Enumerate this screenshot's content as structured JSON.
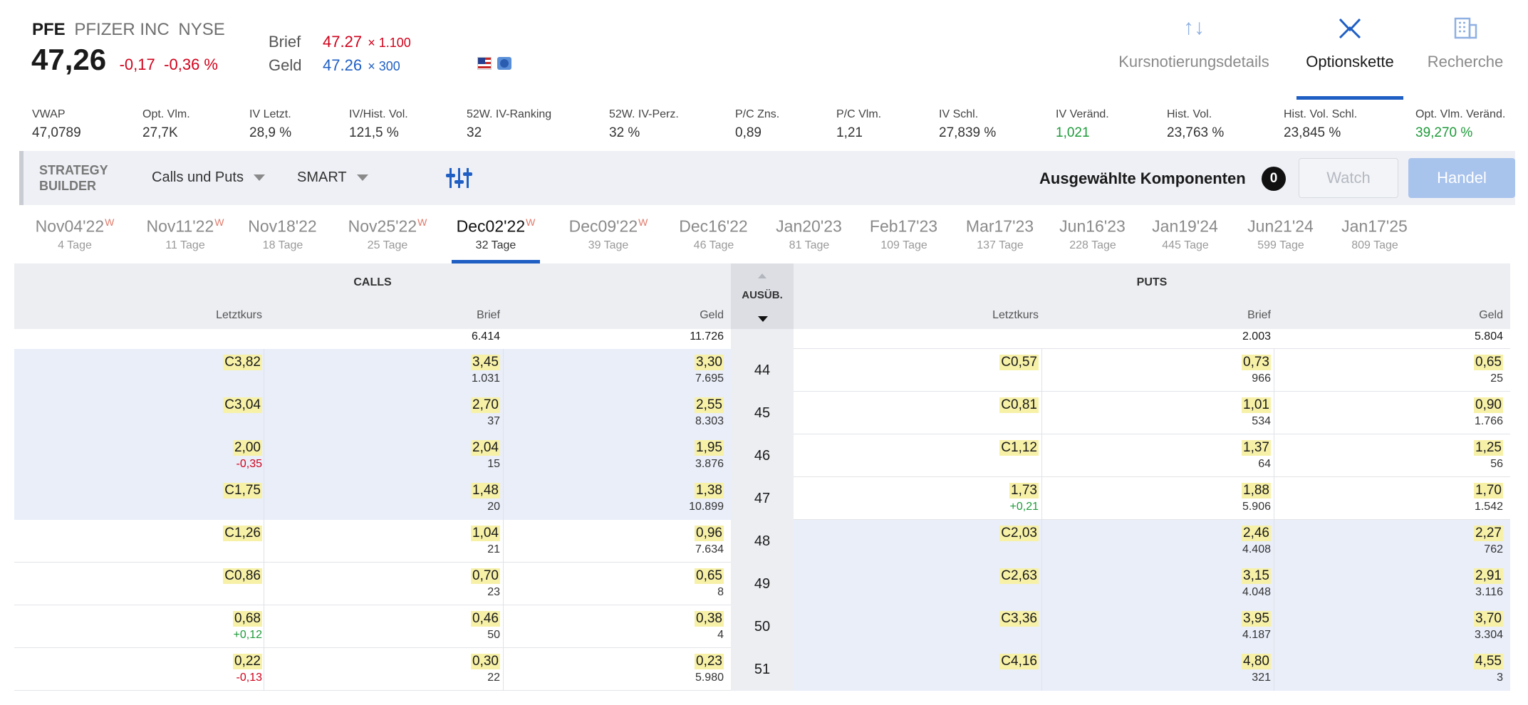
{
  "header": {
    "symbol": "PFE",
    "company": "PFIZER INC",
    "exchange": "NYSE",
    "last_price": "47,26",
    "change": "-0,17",
    "change_pct": "-0,36 %",
    "ask_label": "Brief",
    "ask_price": "47.27",
    "ask_size": "× 1.100",
    "bid_label": "Geld",
    "bid_price": "47.26",
    "bid_size": "× 300"
  },
  "nav_tabs": [
    {
      "label": "Kursnotierungsdetails",
      "icon": "sort-arrows-icon",
      "active": false
    },
    {
      "label": "Optionskette",
      "icon": "options-chain-icon",
      "active": true
    },
    {
      "label": "Recherche",
      "icon": "building-icon",
      "active": false
    }
  ],
  "stats": [
    {
      "label": "VWAP",
      "value": "47,0789",
      "tone": "neutral"
    },
    {
      "label": "Opt. Vlm.",
      "value": "27,7K",
      "tone": "neutral"
    },
    {
      "label": "IV Letzt.",
      "value": "28,9 %",
      "tone": "neutral"
    },
    {
      "label": "IV/Hist. Vol.",
      "value": "121,5 %",
      "tone": "neutral"
    },
    {
      "label": "52W. IV-Ranking",
      "value": "32",
      "tone": "neutral"
    },
    {
      "label": "52W. IV-Perz.",
      "value": "32 %",
      "tone": "neutral"
    },
    {
      "label": "P/C Zns.",
      "value": "0,89",
      "tone": "neutral"
    },
    {
      "label": "P/C Vlm.",
      "value": "1,21",
      "tone": "neutral"
    },
    {
      "label": "IV Schl.",
      "value": "27,839 %",
      "tone": "neutral"
    },
    {
      "label": "IV Veränd.",
      "value": "1,021",
      "tone": "positive"
    },
    {
      "label": "Hist. Vol.",
      "value": "23,763 %",
      "tone": "neutral"
    },
    {
      "label": "Hist. Vol. Schl.",
      "value": "23,845 %",
      "tone": "neutral"
    },
    {
      "label": "Opt. Vlm. Veränd.",
      "value": "39,270 %",
      "tone": "positive"
    }
  ],
  "toolbar": {
    "strategy_builder_line1": "STRATEGY",
    "strategy_builder_line2": "BUILDER",
    "type_dropdown": "Calls und Puts",
    "exchange_dropdown": "SMART",
    "selected_label": "Ausgewählte Komponenten",
    "selected_count": "0",
    "watch_label": "Watch",
    "trade_label": "Handel"
  },
  "expiries": [
    {
      "date": "Nov04'22",
      "weekly": "W",
      "days": "4 Tage",
      "active": false
    },
    {
      "date": "Nov11'22",
      "weekly": "W",
      "days": "11 Tage",
      "active": false
    },
    {
      "date": "Nov18'22",
      "weekly": "",
      "days": "18 Tage",
      "active": false
    },
    {
      "date": "Nov25'22",
      "weekly": "W",
      "days": "25 Tage",
      "active": false
    },
    {
      "date": "Dec02'22",
      "weekly": "W",
      "days": "32 Tage",
      "active": true
    },
    {
      "date": "Dec09'22",
      "weekly": "W",
      "days": "39 Tage",
      "active": false
    },
    {
      "date": "Dec16'22",
      "weekly": "",
      "days": "46 Tage",
      "active": false
    },
    {
      "date": "Jan20'23",
      "weekly": "",
      "days": "81 Tage",
      "active": false
    },
    {
      "date": "Feb17'23",
      "weekly": "",
      "days": "109 Tage",
      "active": false
    },
    {
      "date": "Mar17'23",
      "weekly": "",
      "days": "137 Tage",
      "active": false
    },
    {
      "date": "Jun16'23",
      "weekly": "",
      "days": "228 Tage",
      "active": false
    },
    {
      "date": "Jan19'24",
      "weekly": "",
      "days": "445 Tage",
      "active": false
    },
    {
      "date": "Jun21'24",
      "weekly": "",
      "days": "599 Tage",
      "active": false
    },
    {
      "date": "Jan17'25",
      "weekly": "",
      "days": "809 Tage",
      "active": false
    }
  ],
  "chain": {
    "calls_title": "CALLS",
    "puts_title": "PUTS",
    "strike_title": "AUSÜB.",
    "col_last": "Letztkurs",
    "col_ask": "Brief",
    "col_bid": "Geld",
    "partial_row": {
      "call_ask_size": "6.414",
      "call_bid_size": "11.726",
      "put_ask_size": "2.003",
      "put_bid_size": "5.804"
    },
    "rows": [
      {
        "strike": "44",
        "call_itm": true,
        "put_itm": false,
        "call": {
          "last": "C3,82",
          "last_chg": "",
          "ask": "3,45",
          "ask_size": "1.031",
          "bid": "3,30",
          "bid_size": "7.695"
        },
        "put": {
          "last": "C0,57",
          "last_chg": "",
          "ask": "0,73",
          "ask_size": "966",
          "bid": "0,65",
          "bid_size": "25"
        }
      },
      {
        "strike": "45",
        "call_itm": true,
        "put_itm": false,
        "call": {
          "last": "C3,04",
          "last_chg": "",
          "ask": "2,70",
          "ask_size": "37",
          "bid": "2,55",
          "bid_size": "8.303"
        },
        "put": {
          "last": "C0,81",
          "last_chg": "",
          "ask": "1,01",
          "ask_size": "534",
          "bid": "0,90",
          "bid_size": "1.766"
        }
      },
      {
        "strike": "46",
        "call_itm": true,
        "put_itm": false,
        "call": {
          "last": "2,00",
          "last_chg": "-0,35",
          "ask": "2,04",
          "ask_size": "15",
          "bid": "1,95",
          "bid_size": "3.876"
        },
        "put": {
          "last": "C1,12",
          "last_chg": "",
          "ask": "1,37",
          "ask_size": "64",
          "bid": "1,25",
          "bid_size": "56"
        }
      },
      {
        "strike": "47",
        "call_itm": true,
        "put_itm": false,
        "call": {
          "last": "C1,75",
          "last_chg": "",
          "ask": "1,48",
          "ask_size": "20",
          "bid": "1,38",
          "bid_size": "10.899"
        },
        "put": {
          "last": "1,73",
          "last_chg": "+0,21",
          "ask": "1,88",
          "ask_size": "5.906",
          "bid": "1,70",
          "bid_size": "1.542"
        }
      },
      {
        "strike": "48",
        "call_itm": false,
        "put_itm": true,
        "call": {
          "last": "C1,26",
          "last_chg": "",
          "ask": "1,04",
          "ask_size": "21",
          "bid": "0,96",
          "bid_size": "7.634"
        },
        "put": {
          "last": "C2,03",
          "last_chg": "",
          "ask": "2,46",
          "ask_size": "4.408",
          "bid": "2,27",
          "bid_size": "762"
        }
      },
      {
        "strike": "49",
        "call_itm": false,
        "put_itm": true,
        "call": {
          "last": "C0,86",
          "last_chg": "",
          "ask": "0,70",
          "ask_size": "23",
          "bid": "0,65",
          "bid_size": "8"
        },
        "put": {
          "last": "C2,63",
          "last_chg": "",
          "ask": "3,15",
          "ask_size": "4.048",
          "bid": "2,91",
          "bid_size": "3.116"
        }
      },
      {
        "strike": "50",
        "call_itm": false,
        "put_itm": true,
        "call": {
          "last": "0,68",
          "last_chg": "+0,12",
          "ask": "0,46",
          "ask_size": "50",
          "bid": "0,38",
          "bid_size": "4"
        },
        "put": {
          "last": "C3,36",
          "last_chg": "",
          "ask": "3,95",
          "ask_size": "4.187",
          "bid": "3,70",
          "bid_size": "3.304"
        }
      },
      {
        "strike": "51",
        "call_itm": false,
        "put_itm": true,
        "call": {
          "last": "0,22",
          "last_chg": "-0,13",
          "ask": "0,30",
          "ask_size": "22",
          "bid": "0,23",
          "bid_size": "5.980"
        },
        "put": {
          "last": "C4,16",
          "last_chg": "",
          "ask": "4,80",
          "ask_size": "321",
          "bid": "4,55",
          "bid_size": "3"
        }
      }
    ]
  }
}
